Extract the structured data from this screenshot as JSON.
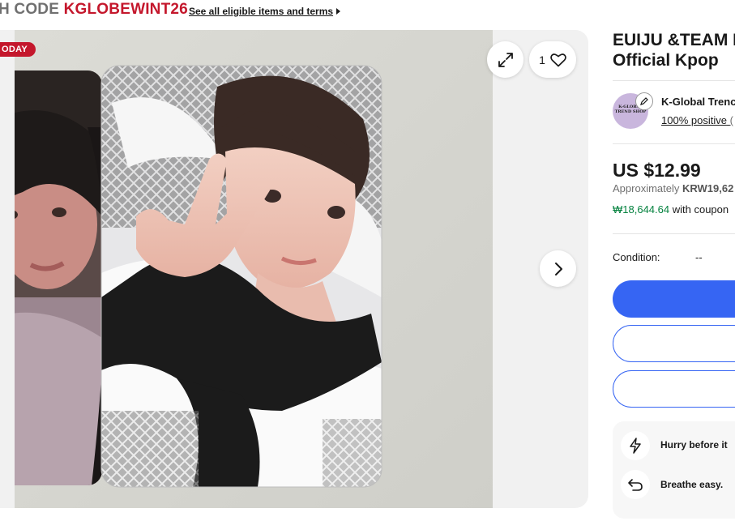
{
  "promo": {
    "prefix": "H CODE",
    "code": "KGLOBEWINT26",
    "link": "See all eligible items and terms"
  },
  "gallery": {
    "badge": "ODAY",
    "favorite_count": "1",
    "icons": [
      "expand-icon",
      "heart-icon",
      "chevron-right-icon"
    ]
  },
  "listing": {
    "title_line1": "EUIJU &TEAM F",
    "title_line2": "Official Kpop",
    "seller": {
      "name": "K-Global Trenc",
      "feedback": "100% positive",
      "feedback_tail": "(",
      "avatar_text": "K-GLOBAL TREND SHOP"
    },
    "price": "US $12.99",
    "approx_label": "Approximately",
    "approx_value": "KRW19,62",
    "coupon_price": "₩18,644.64",
    "coupon_suffix": "with coupon",
    "condition_label": "Condition:",
    "condition_value": "--",
    "info": [
      {
        "icon": "lightning-icon",
        "text": "Hurry before it"
      },
      {
        "icon": "return-icon",
        "text": "Breathe easy."
      }
    ]
  },
  "colors": {
    "accent": "#3665f3",
    "promo_red": "#c4172c",
    "coupon_green": "#05823f"
  }
}
